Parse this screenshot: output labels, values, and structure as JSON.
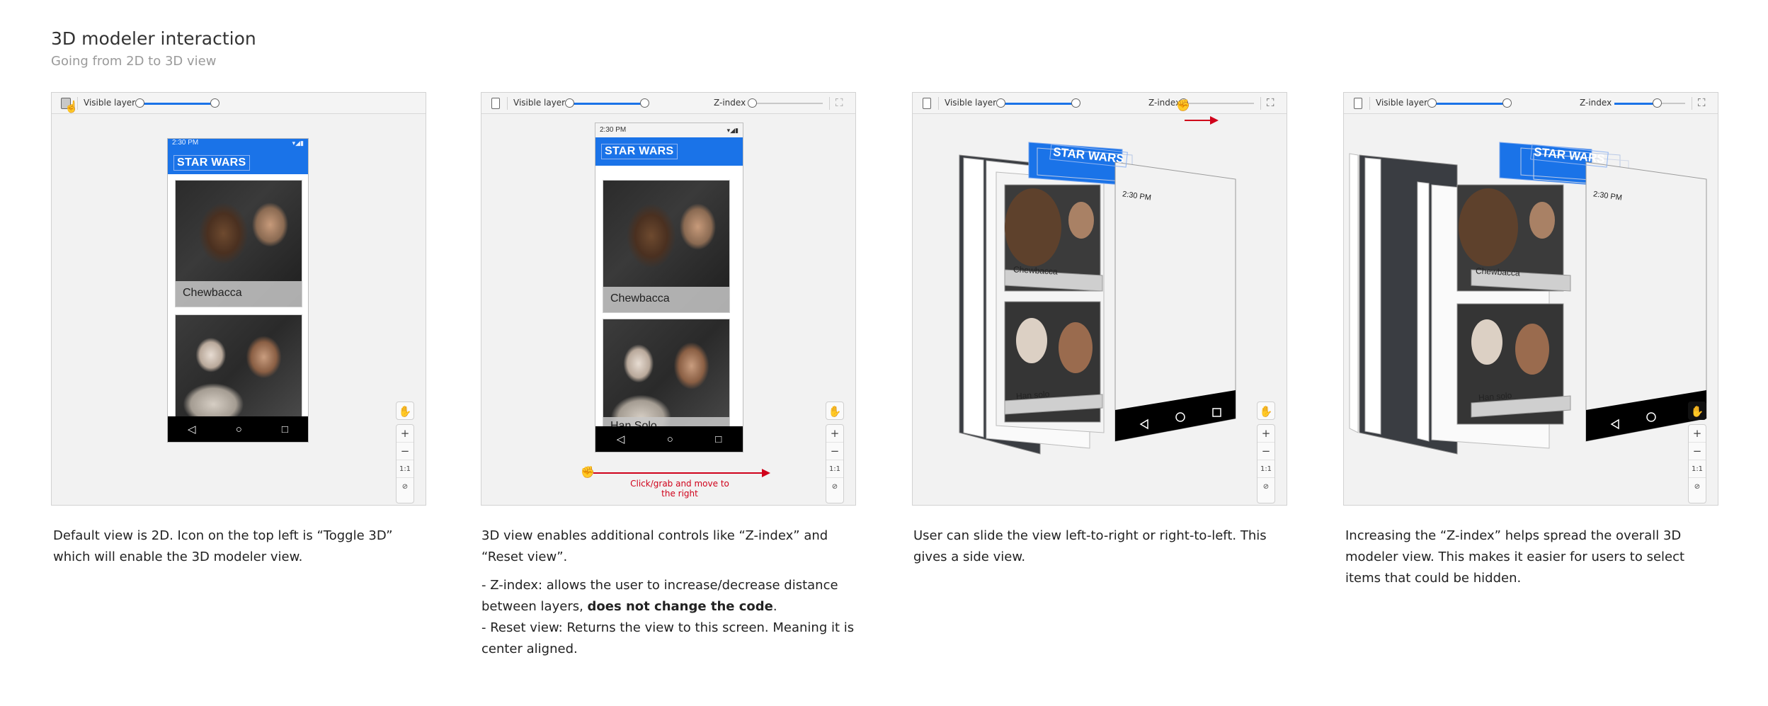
{
  "header": {
    "title": "3D modeler interaction",
    "subtitle": "Going from 2D to 3D view"
  },
  "toolbar": {
    "visible_layers_label": "Visible layers",
    "z_index_label": "Z-index"
  },
  "zoom_controls": {
    "pan_icon": "hand-icon",
    "zoom_in": "+",
    "zoom_out": "−",
    "actual_size": "1:1",
    "fit": "⊘"
  },
  "phone": {
    "status_time": "2:30 PM",
    "app_title": "STAR WARS",
    "cards": [
      {
        "label": "Chewbacca"
      },
      {
        "label": "Han Solo"
      },
      {
        "label": "Han solo"
      }
    ],
    "nav_back": "◁",
    "nav_home": "○",
    "nav_recent": "□"
  },
  "panels": [
    {
      "description": [
        "Default view is 2D. Icon on the top left is “Toggle 3D” which will enable the 3D modeler view."
      ]
    },
    {
      "description": [
        "3D view enables additional controls like “Z-index” and “Reset view”."
      ],
      "bullets": [
        {
          "text": "- Z-index: allows the user to increase/decrease distance between layers, ",
          "bold": "does not change the code",
          "tail": "."
        },
        {
          "text": "- Reset view: Returns the view to this screen. Meaning it is center aligned.",
          "bold": "",
          "tail": ""
        }
      ],
      "arrow_caption": "Click/grab and move to the right"
    },
    {
      "description": [
        "User can slide the view left-to-right or right-to-left. This gives a side view."
      ]
    },
    {
      "description": [
        "Increasing the “Z-index” helps spread the overall 3D modeler view. This makes it easier for users to select items that could be hidden."
      ]
    }
  ],
  "colors": {
    "accent": "#1a73e8",
    "annotation": "#d0021b"
  }
}
